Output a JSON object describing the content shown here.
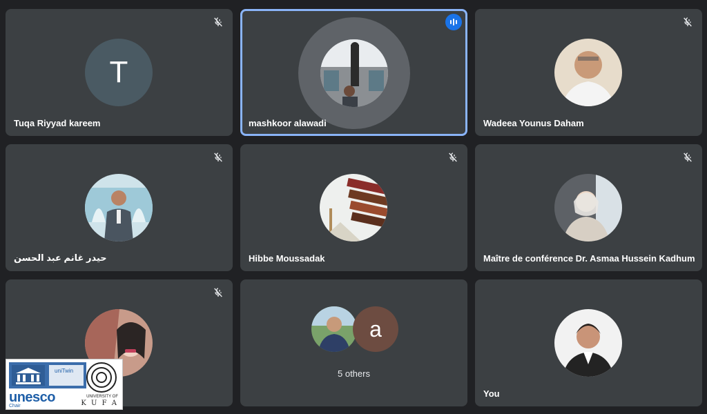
{
  "tiles": [
    {
      "id": "t1",
      "name": "Tuqa Riyyad kareem",
      "avatar_letter": "T",
      "muted": true
    },
    {
      "id": "t2",
      "name": "mashkoor alawadi",
      "speaking": true
    },
    {
      "id": "t3",
      "name": "Wadeea Younus Daham",
      "muted": true
    },
    {
      "id": "t4",
      "name": "حيدر غانم عبد الحسن",
      "muted": true
    },
    {
      "id": "t5",
      "name": "Hibbe Moussadak",
      "muted": true
    },
    {
      "id": "t6",
      "name": "Maître de conférence Dr. Asmaa Hussein Kadhum",
      "muted": true
    },
    {
      "id": "t7",
      "name": "",
      "muted": true
    },
    {
      "id": "t8",
      "others_label": "5 others",
      "avatar_letter": "a"
    },
    {
      "id": "t9",
      "name": "You"
    }
  ],
  "logo": {
    "unesco": "unesco",
    "chair": "Chair",
    "unitwin": "uniTwin",
    "university_of": "UNIVERSITY OF",
    "kufa": "K U F A"
  },
  "colors": {
    "background": "#202124",
    "tile": "#3c4043",
    "active_border": "#8ab4f8",
    "speaking_badge": "#1a73e8",
    "letter_avatar": "#4a5a63",
    "others_avatar": "#6d4c41"
  }
}
